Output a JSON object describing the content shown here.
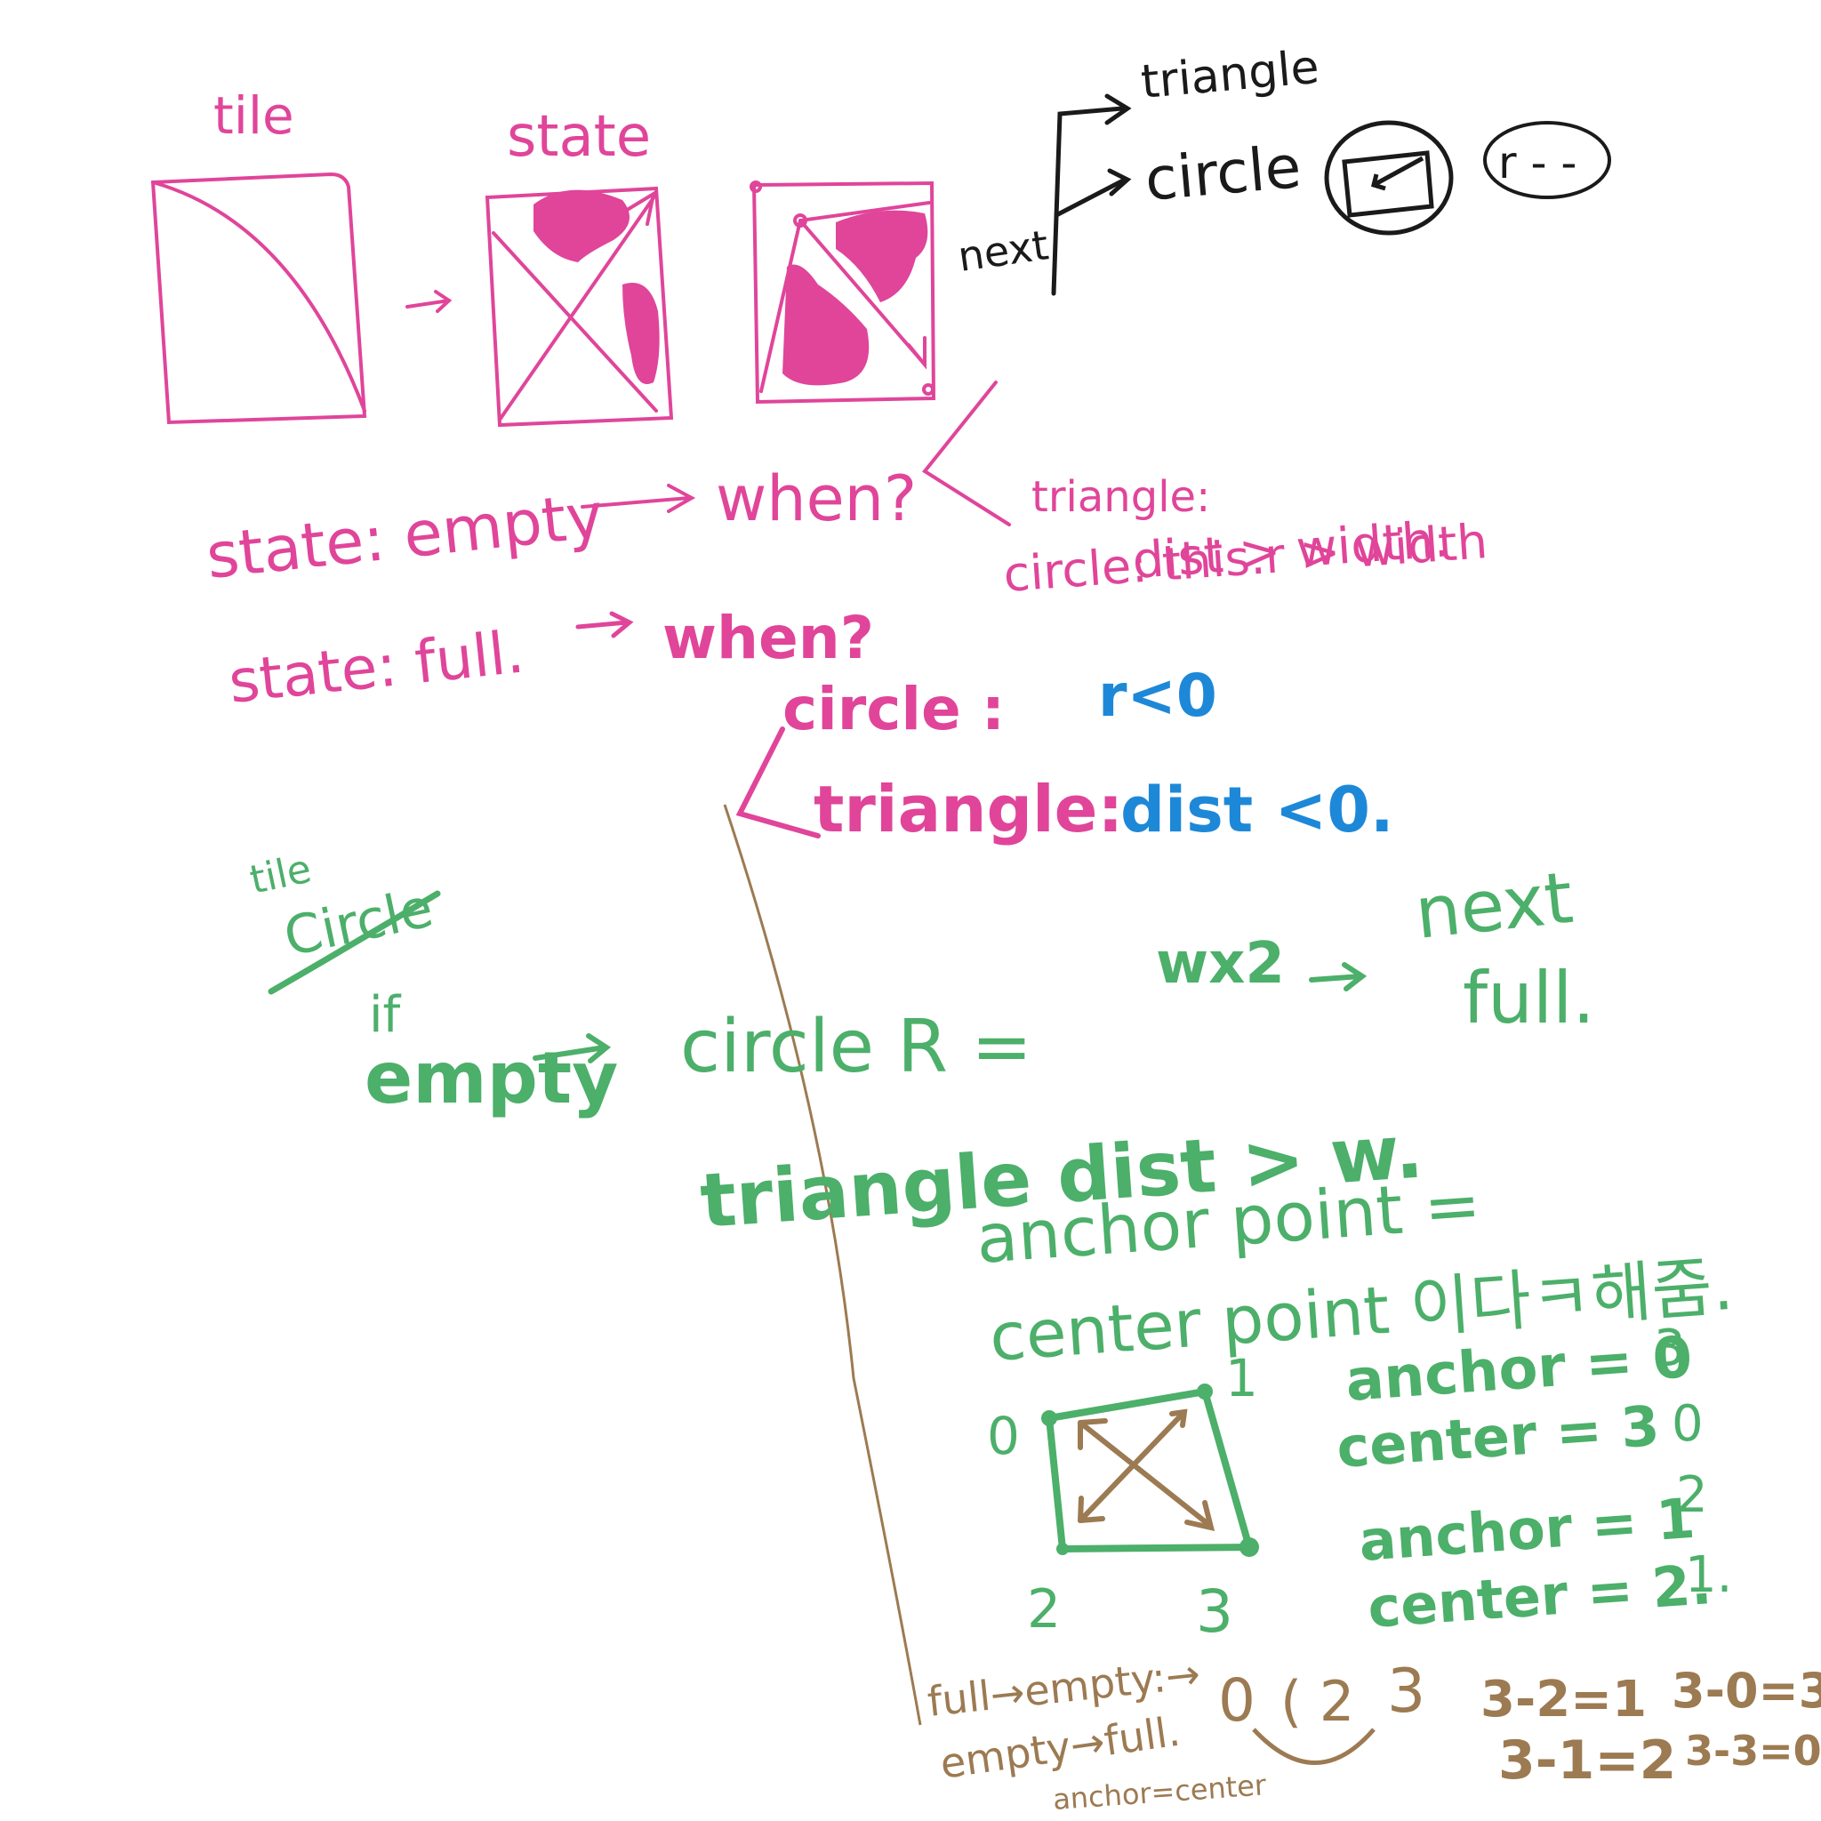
{
  "colors": {
    "pink": "#e0459a",
    "green": "#4caf6a",
    "blue": "#1e88d8",
    "brown": "#9c7a52",
    "black": "#1a1a1a"
  },
  "top": {
    "tile": "tile",
    "state": "state",
    "next": "next",
    "triangle": "triangle",
    "circle": "circle",
    "r_dash": "r - -"
  },
  "conditions": {
    "circle_cond": "circle: this.r > width",
    "triangle_label": "triangle:",
    "triangle_cond": "dist > width.",
    "state_empty": "state: empty",
    "when1": "when?",
    "state_full": "state: full.",
    "when2": "when?",
    "circle2": "circle :",
    "circle2_value": "r<0",
    "triangle2": "triangle:",
    "triangle2_value": "dist <0."
  },
  "green_notes": {
    "tile": "tile",
    "circle_heading": "Circle",
    "if": "if",
    "empty": "empty",
    "circle_r": "circle R =",
    "wx2": "wx2",
    "next": "next",
    "full": "full.",
    "triangle_dist": "triangle dist > w.",
    "anchor_point": "anchor point =",
    "center_point": "center point 이다ㅋ해줌.",
    "corner0": "0",
    "corner1": "1",
    "corner2": "2",
    "corner3": "3",
    "anchor_a": "anchor = 0",
    "anchor_a_alt": "3",
    "center_a": "center = 3",
    "center_a_alt": "0",
    "anchor_b": "anchor = 1",
    "anchor_b_alt": "2",
    "center_b": "center = 2.",
    "center_b_alt": "1."
  },
  "brown_notes": {
    "full_empty": "full→empty:→",
    "empty_full": "empty→full.",
    "anchor_center": "anchor=center",
    "seq0": "0",
    "seq12": "( 2",
    "seq3": "3",
    "calc1": "3-2=1",
    "calc2": "3-0=3",
    "calc3": "3-1=2",
    "calc4": "3-3=0"
  }
}
